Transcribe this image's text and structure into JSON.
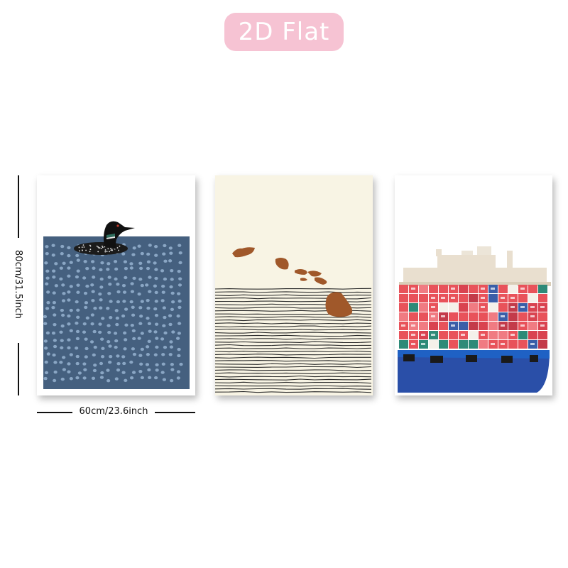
{
  "badge": {
    "label": "2D Flat",
    "color": "#f6c3d3"
  },
  "dimensions": {
    "height_label": "80cm/31.5inch",
    "width_label": "60cm/23.6inch"
  },
  "posters": [
    {
      "subject": "loon-on-dotted-water",
      "background": "#ffffff",
      "water_color": "#45607f"
    },
    {
      "subject": "hawaiian-islands-over-lined-sea",
      "background": "#f8f4e4",
      "island_color": "#a0582a"
    },
    {
      "subject": "container-ship-bow",
      "background": "#ffffff",
      "hull_color": "#2a4fa8",
      "container_color": "#e8525a"
    }
  ]
}
